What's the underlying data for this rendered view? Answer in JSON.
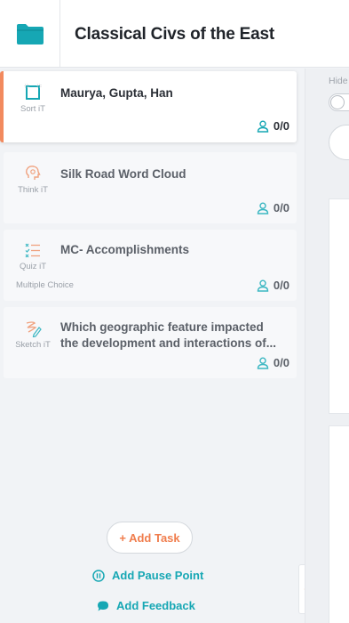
{
  "header": {
    "title": "Classical Civs of the East",
    "folder_icon": "folder-icon",
    "accent": "#16a7b4"
  },
  "tasks": [
    {
      "title": "Maurya, Gupta, Han",
      "type": "Sort iT",
      "sub_label": "",
      "count": "0/0",
      "icon": "sort-icon",
      "active": true
    },
    {
      "title": "Silk Road Word Cloud",
      "type": "Think iT",
      "sub_label": "",
      "count": "0/0",
      "icon": "think-icon",
      "active": false
    },
    {
      "title": "MC- Accomplishments",
      "type": "Quiz iT",
      "sub_label": "Multiple Choice",
      "count": "0/0",
      "icon": "quiz-icon",
      "active": false
    },
    {
      "title": "Which geographic feature impacted the development and interactions of...",
      "type": "Sketch iT",
      "sub_label": "",
      "count": "0/0",
      "icon": "sketch-icon",
      "active": false
    }
  ],
  "actions": {
    "add_task": "+ Add Task",
    "add_pause_point": "Add Pause Point",
    "add_feedback": "Add Feedback"
  },
  "right_pane": {
    "hide_label": "Hide"
  },
  "colors": {
    "orange": "#f07d4d",
    "teal": "#16a7b4"
  }
}
